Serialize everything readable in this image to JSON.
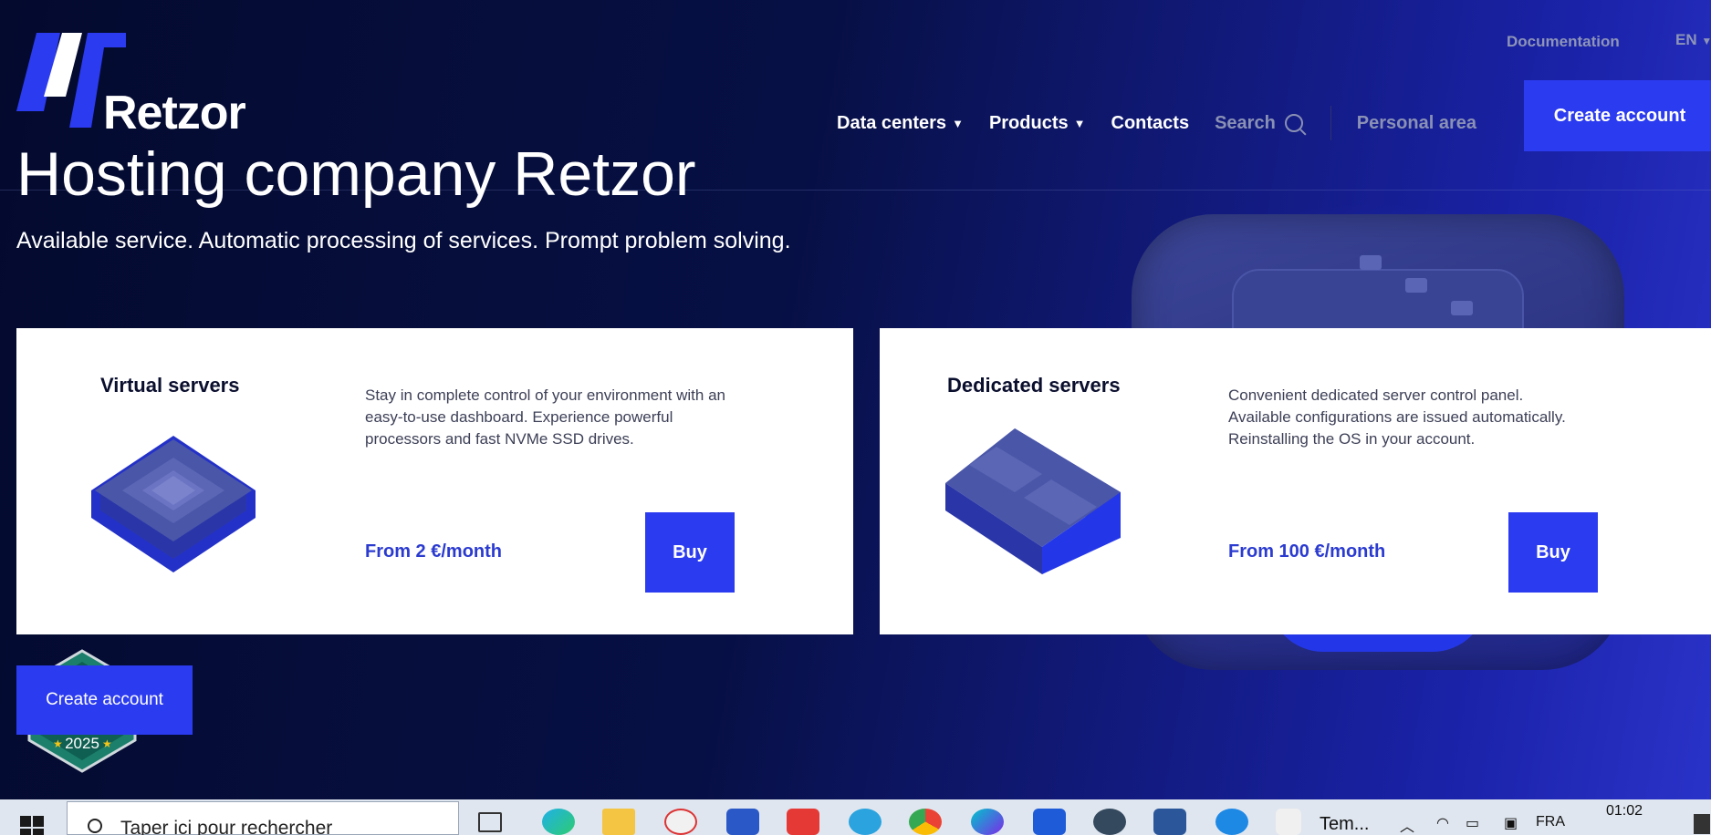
{
  "brand": {
    "name": "Retzor",
    "accent": "#2b3bf0"
  },
  "top_links": {
    "documentation": "Documentation",
    "language": "EN"
  },
  "nav": {
    "data_centers": "Data centers",
    "products": "Products",
    "contacts": "Contacts",
    "search": "Search",
    "personal_area": "Personal area",
    "create_account": "Create account"
  },
  "hero": {
    "title": "Hosting company Retzor",
    "subtitle": "Available service. Automatic processing of services. Prompt problem solving."
  },
  "cards": [
    {
      "title": "Virtual servers",
      "description": "Stay in complete control of your environment with an easy-to-use dashboard. Experience powerful processors and fast NVMe SSD drives.",
      "price": "From 2 €/month",
      "buy": "Buy"
    },
    {
      "title": "Dedicated servers",
      "description": "Convenient dedicated server control panel. Available configurations are issued automatically. Reinstalling the OS in your account.",
      "price": "From 100 €/month",
      "buy": "Buy"
    }
  ],
  "bottom": {
    "create_account": "Create account",
    "badge_year": "2025"
  },
  "taskbar": {
    "search_placeholder": "Taper ici pour rechercher",
    "pinned_label": "Tem...",
    "language": "FRA",
    "time": "01:02"
  }
}
